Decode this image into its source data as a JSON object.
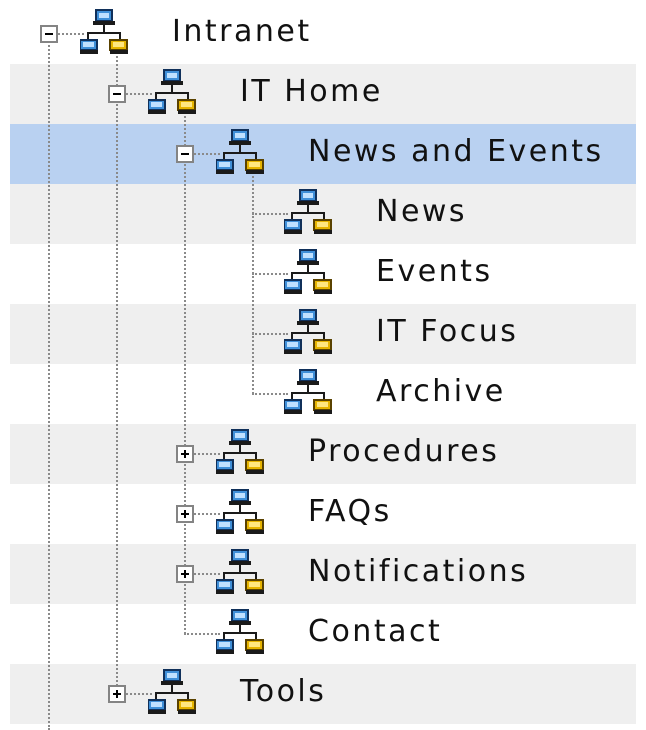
{
  "tree": {
    "nodes": [
      {
        "label": "Intranet",
        "level": 0,
        "toggle": "minus",
        "icon": "network-icon"
      },
      {
        "label": "IT Home",
        "level": 1,
        "toggle": "minus",
        "icon": "network-icon"
      },
      {
        "label": "News and Events",
        "level": 2,
        "toggle": "minus",
        "icon": "network-icon",
        "selected": true
      },
      {
        "label": "News",
        "level": 3,
        "toggle": "none",
        "icon": "network-icon"
      },
      {
        "label": "Events",
        "level": 3,
        "toggle": "none",
        "icon": "network-icon"
      },
      {
        "label": "IT Focus",
        "level": 3,
        "toggle": "none",
        "icon": "network-icon"
      },
      {
        "label": "Archive",
        "level": 3,
        "toggle": "none",
        "icon": "network-icon"
      },
      {
        "label": "Procedures",
        "level": 2,
        "toggle": "plus",
        "icon": "network-icon"
      },
      {
        "label": "FAQs",
        "level": 2,
        "toggle": "plus",
        "icon": "network-icon"
      },
      {
        "label": "Notifications",
        "level": 2,
        "toggle": "plus",
        "icon": "network-icon"
      },
      {
        "label": "Contact",
        "level": 2,
        "toggle": "none",
        "icon": "network-icon"
      },
      {
        "label": "Tools",
        "level": 1,
        "toggle": "plus",
        "icon": "network-icon"
      }
    ]
  },
  "colors": {
    "selected_row": "#b9d1f1",
    "alt_row": "#efefef",
    "connector": "#8a8a8a",
    "toggle_border": "#848484",
    "icon_blue": "#3f8fd8",
    "icon_gold": "#e6b400"
  }
}
